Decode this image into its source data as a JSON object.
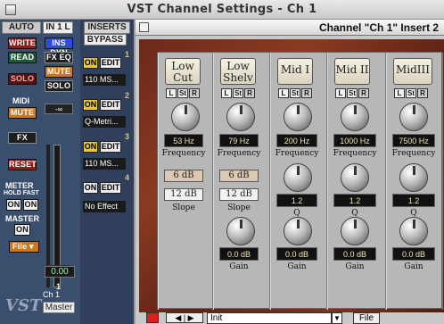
{
  "window_title": "VST Channel Settings - Ch 1",
  "strip": {
    "auto_label": "AUTO",
    "io_label": "IN 1 L",
    "inserts_header": "INSERTS",
    "write": "WRITE",
    "read": "READ",
    "solo_top": "SOLO",
    "ins_byp": "INS DYN",
    "fx_eq": "FX EQ",
    "mute_small": "MUTE",
    "solo": "SOLO",
    "midi_label": "MIDI",
    "mute": "MUTE",
    "inf_label": "-∞",
    "fx": "FX",
    "reset": "RESET",
    "meter_label": "METER",
    "hold_fast_label": "HOLD FAST",
    "on1": "ON",
    "on2": "ON",
    "master_label": "MASTER",
    "master_on": "ON",
    "file": "File",
    "fader_value": "0.00",
    "channel_num": "1",
    "channel_name": "Ch 1",
    "bus": "Master"
  },
  "inserts": {
    "bypass": "BYPASS",
    "slots": [
      {
        "num": "1",
        "on": "ON",
        "edit": "EDIT",
        "name": "110 MS..."
      },
      {
        "num": "2",
        "on": "ON",
        "edit": "EDIT",
        "name": "Q-Metri..."
      },
      {
        "num": "3",
        "on": "ON",
        "edit": "EDIT",
        "name": "110 MS..."
      },
      {
        "num": "4",
        "on": "ON",
        "edit": "EDIT",
        "name": "No Effect"
      }
    ]
  },
  "plugin": {
    "title": "Channel \"Ch 1\" Insert 2",
    "bands": [
      {
        "name_line1": "Low",
        "name_line2": "Cut",
        "freq": "53 Hz",
        "freq_label": "Frequency",
        "slope_top": "6 dB",
        "slope_bottom": "12 dB",
        "slope_label": "Slope"
      },
      {
        "name_line1": "Low",
        "name_line2": "Shelv",
        "freq": "79 Hz",
        "freq_label": "Frequency",
        "slope_top": "6 dB",
        "slope_bottom": "12 dB",
        "slope_label": "Slope",
        "gain": "0.0 dB",
        "gain_label": "Gain"
      },
      {
        "name_line1": "Mid I",
        "freq": "200 Hz",
        "freq_label": "Frequency",
        "q": "1.2",
        "q_label": "Q",
        "gain": "0.0 dB",
        "gain_label": "Gain"
      },
      {
        "name_line1": "Mid II",
        "freq": "1000 Hz",
        "freq_label": "Frequency",
        "q": "1.2",
        "q_label": "Q",
        "gain": "0.0 dB",
        "gain_label": "Gain"
      },
      {
        "name_line1": "MidIII",
        "freq": "7500 Hz",
        "freq_label": "Frequency",
        "q": "1.2",
        "q_label": "Q",
        "gain": "0.0 dB",
        "gain_label": "Gain"
      }
    ],
    "lstr": [
      "L",
      "St",
      "R"
    ],
    "preset": "Init",
    "file": "File"
  },
  "colors": {
    "accent_red": "#8c1d1d",
    "active_yellow": "#e8c83a",
    "wood": "#6b2a1a"
  }
}
